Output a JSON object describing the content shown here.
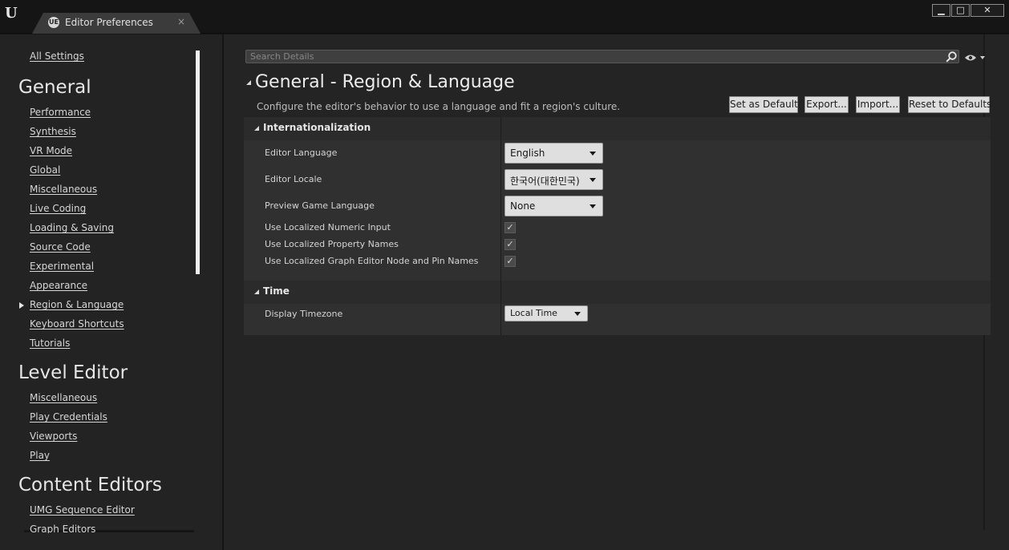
{
  "window": {
    "logo": "U",
    "tab_icon_text": "UE",
    "tab_title": "Editor Preferences",
    "tab_close": "×",
    "minimize": "▁",
    "maximize": "□",
    "close": "✕"
  },
  "sidebar": {
    "all_settings": "All Settings",
    "sections": [
      {
        "title": "General",
        "items": [
          "Performance",
          "Synthesis",
          "VR Mode",
          "Global",
          "Miscellaneous",
          "Live Coding",
          "Loading & Saving",
          "Source Code",
          "Experimental",
          "Appearance",
          "Region & Language",
          "Keyboard Shortcuts",
          "Tutorials"
        ]
      },
      {
        "title": "Level Editor",
        "items": [
          "Miscellaneous",
          "Play Credentials",
          "Viewports",
          "Play"
        ]
      },
      {
        "title": "Content Editors",
        "items": [
          "UMG Sequence Editor",
          "Graph Editors"
        ]
      }
    ],
    "selected": "Region & Language"
  },
  "search": {
    "placeholder": "Search Details"
  },
  "page": {
    "title": "General - Region & Language",
    "description": "Configure the editor's behavior to use a language and fit a region's culture."
  },
  "buttons": {
    "set_default": "Set as Default",
    "export": "Export...",
    "import": "Import...",
    "reset": "Reset to Defaults"
  },
  "categories": {
    "internationalization": {
      "title": "Internationalization",
      "editor_language_label": "Editor Language",
      "editor_language_value": "English",
      "editor_locale_label": "Editor Locale",
      "editor_locale_value": "한국어(대한민국)",
      "preview_game_language_label": "Preview Game Language",
      "preview_game_language_value": "None",
      "numeric_input_label": "Use Localized Numeric Input",
      "numeric_input_checked": true,
      "property_names_label": "Use Localized Property Names",
      "property_names_checked": true,
      "graph_names_label": "Use Localized Graph Editor Node and Pin Names",
      "graph_names_checked": true
    },
    "time": {
      "title": "Time",
      "display_timezone_label": "Display Timezone",
      "display_timezone_value": "Local Time"
    }
  },
  "checkmark": "✓"
}
